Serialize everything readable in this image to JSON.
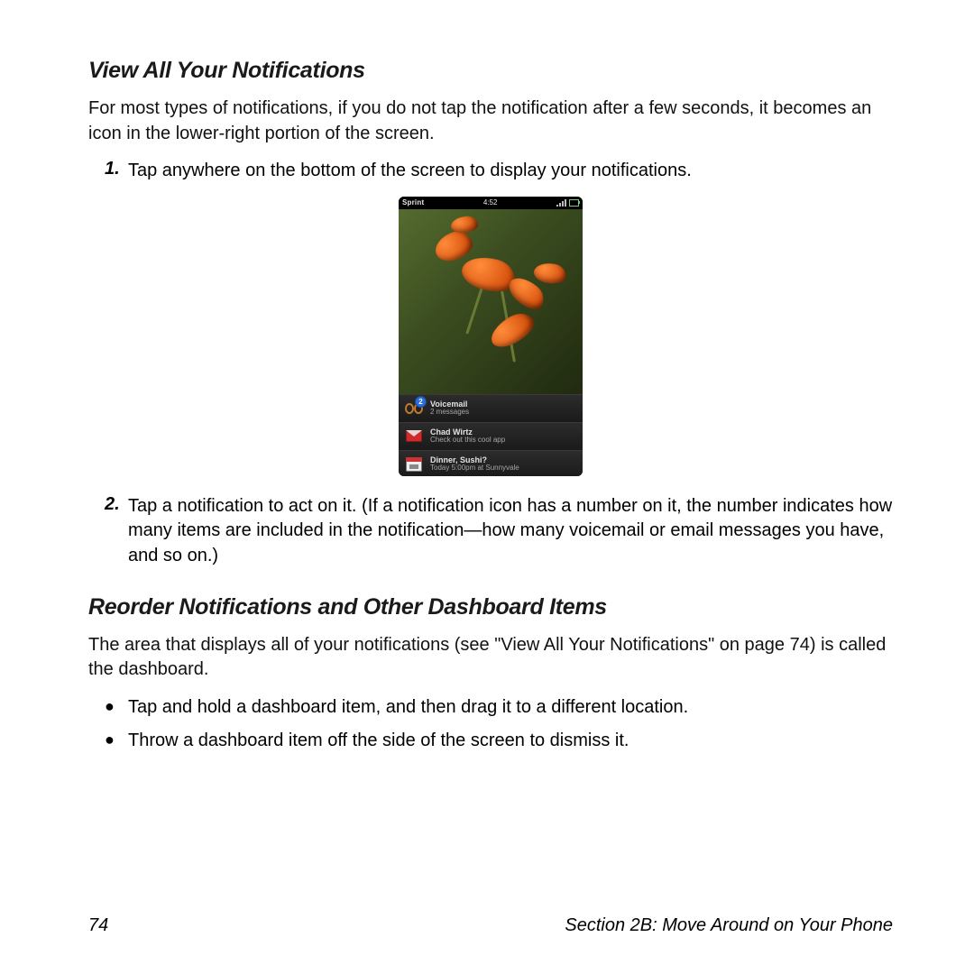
{
  "section1": {
    "title": "View All Your Notifications",
    "intro": "For most types of notifications, if you do not tap the notification after a few seconds, it becomes an icon in the lower-right portion of the screen.",
    "step1_num": "1.",
    "step1": "Tap anywhere on the bottom of the screen to display your notifications.",
    "step2_num": "2.",
    "step2": "Tap a notification to act on it. (If a notification icon has a number on it, the number indicates how many items are included in the notification—how many voicemail or email messages you have, and so on.)"
  },
  "section2": {
    "title": "Reorder Notifications and Other Dashboard Items",
    "intro": "The area that displays all of your notifications (see \"View All Your Notifications\" on page 74) is called the dashboard.",
    "bullet1": "Tap and hold a dashboard item, and then drag it to a different location.",
    "bullet2": "Throw a dashboard item off the side of the screen to dismiss it."
  },
  "phone": {
    "carrier": "Sprint",
    "time": "4:52",
    "notifs": [
      {
        "badge": "2",
        "title": "Voicemail",
        "sub": "2 messages"
      },
      {
        "title": "Chad Wirtz",
        "sub": "Check out this cool app"
      },
      {
        "title": "Dinner, Sushi?",
        "sub": "Today 5:00pm at Sunnyvale"
      }
    ]
  },
  "footer": {
    "page": "74",
    "label": "Section 2B: Move Around on Your Phone"
  }
}
